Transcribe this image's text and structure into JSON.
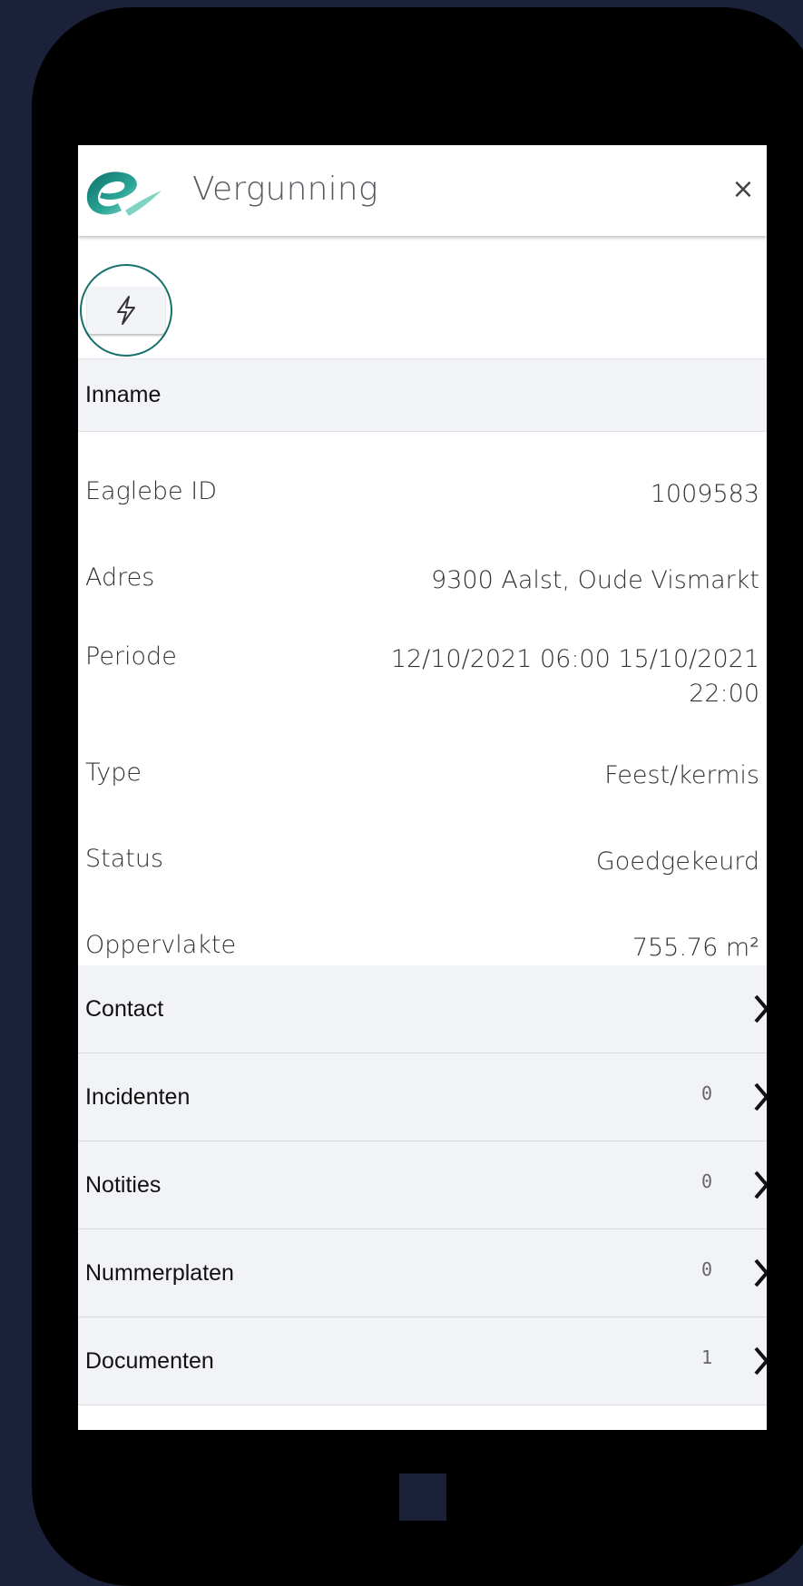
{
  "header": {
    "title": "Vergunning",
    "close_label": "×",
    "logo_icon": "eaglebe-logo-icon",
    "brand_color": "#16706b"
  },
  "actions": {
    "quick_action_icon": "lightning-icon"
  },
  "section": {
    "title": "Inname"
  },
  "details": [
    {
      "label": "Eaglebe ID",
      "value": "1009583"
    },
    {
      "label": "Adres",
      "value": "9300 Aalst, Oude Vismarkt"
    },
    {
      "label": "Periode",
      "value_line1": "12/10/2021 06:00 15/10/2021",
      "value_line2": "22:00"
    },
    {
      "label": "Type",
      "value": "Feest/kermis"
    },
    {
      "label": "Status",
      "value": "Goedgekeurd"
    },
    {
      "label": "Oppervlakte",
      "value": "755.76 m²"
    }
  ],
  "nav_items": [
    {
      "label": "Contact",
      "count": ""
    },
    {
      "label": "Incidenten",
      "count": "0"
    },
    {
      "label": "Notities",
      "count": "0"
    },
    {
      "label": "Nummerplaten",
      "count": "0"
    },
    {
      "label": "Documenten",
      "count": "1"
    }
  ]
}
